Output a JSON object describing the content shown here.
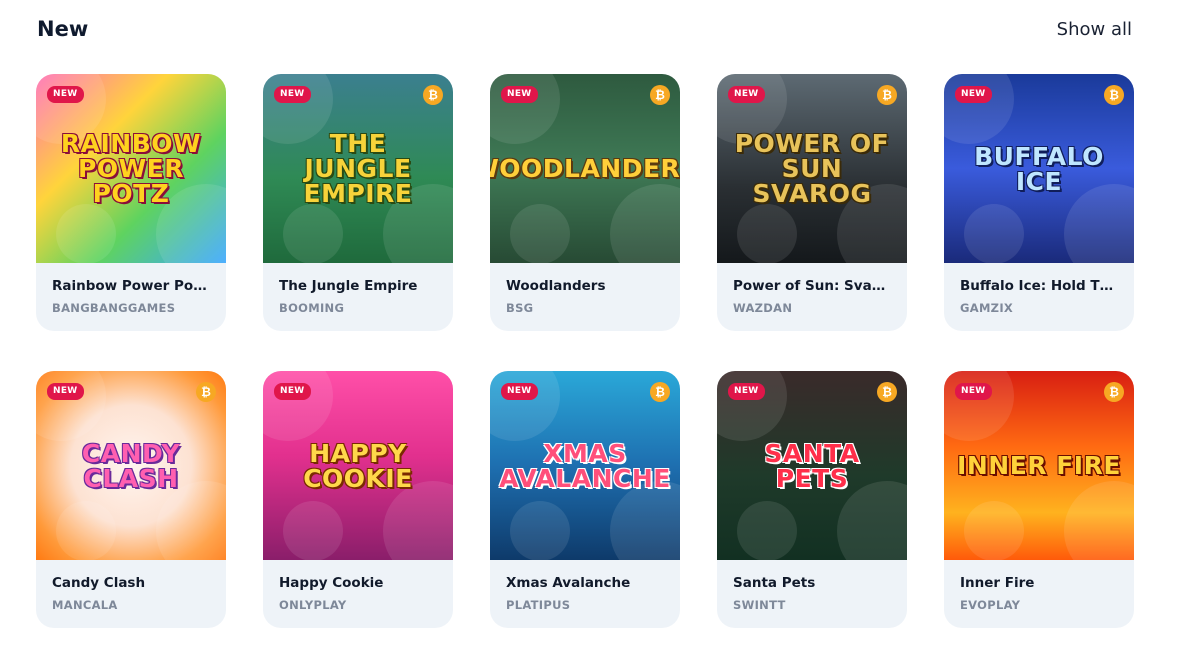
{
  "section": {
    "title": "New",
    "show_all": "Show all"
  },
  "badge_new": "NEW",
  "colors": {
    "badge": "#e0164a",
    "bitcoin": "#f7a823",
    "card_bg": "#eef3f8",
    "provider_text": "#7e8899"
  },
  "games": [
    {
      "name": "Rainbow Power Potz …",
      "provider": "BANGBANGGAMES",
      "thumb_text": "RAINBOW POWER POTZ",
      "btc": false,
      "bg": "linear-gradient(135deg,#ff6fb5 0%,#ffd43b 35%,#5fd35f 65%,#3aa7ff 100%)",
      "fg": "#ffd21f",
      "stroke": "#8a0e3a"
    },
    {
      "name": "The Jungle Empire",
      "provider": "BOOMING",
      "thumb_text": "THE JUNGLE EMPIRE",
      "btc": true,
      "bg": "linear-gradient(180deg,#3b7f8f 0%,#2f8a55 55%,#1f6a3c 100%)",
      "fg": "#f7d33a",
      "stroke": "#2a4a12"
    },
    {
      "name": "Woodlanders",
      "provider": "BSG",
      "thumb_text": "WOODLANDERS",
      "btc": true,
      "bg": "linear-gradient(180deg,#2e5a3f 0%,#3f7a56 50%,#274a34 100%)",
      "fg": "#ffcf3a",
      "stroke": "#5a3a10"
    },
    {
      "name": "Power of Sun: Svarog",
      "provider": "WAZDAN",
      "thumb_text": "POWER OF SUN SVAROG",
      "btc": true,
      "bg": "linear-gradient(180deg,#5d6a73 0%,#2a2f33 60%,#14181b 100%)",
      "fg": "#e8c35a",
      "stroke": "#3a2a08"
    },
    {
      "name": "Buffalo Ice: Hold The …",
      "provider": "GAMZIX",
      "thumb_text": "BUFFALO ICE",
      "btc": true,
      "bg": "linear-gradient(180deg,#1a3a9a 0%,#3a5bdc 50%,#1a2a7a 100%)",
      "fg": "#bfe6ff",
      "stroke": "#101e5a"
    },
    {
      "name": "Candy Clash",
      "provider": "MANCALA",
      "thumb_text": "CANDY CLASH",
      "btc": true,
      "bg": "radial-gradient(circle at 50% 50%,#fff5f0 0%,#fde2d2 45%,#ff9a3a 80%,#ff7a12 100%)",
      "fg": "#ff5fb0",
      "stroke": "#6a2a9a"
    },
    {
      "name": "Happy Cookie",
      "provider": "ONLYPLAY",
      "thumb_text": "HAPPY COOKIE",
      "btc": false,
      "bg": "linear-gradient(180deg,#ff4fa8 0%,#e2308e 45%,#8a1e6a 100%)",
      "fg": "#ffd84a",
      "stroke": "#7a2a00"
    },
    {
      "name": "Xmas Avalanche",
      "provider": "PLATIPUS",
      "thumb_text": "XMAS AVALANCHE",
      "btc": true,
      "bg": "linear-gradient(180deg,#2aa8d8 0%,#1e6fb0 50%,#0e3a6a 100%)",
      "fg": "#ff4f7a",
      "stroke": "#ffffff"
    },
    {
      "name": "Santa Pets",
      "provider": "SWINTT",
      "thumb_text": "SANTA PETS",
      "btc": true,
      "bg": "linear-gradient(180deg,#3a2a2a 0%,#1f3a2a 55%,#123022 100%)",
      "fg": "#ff2f4a",
      "stroke": "#ffffff"
    },
    {
      "name": "Inner Fire",
      "provider": "EVOPLAY",
      "thumb_text": "INNER FIRE",
      "btc": true,
      "bg": "linear-gradient(180deg,#d81e12 0%,#ff6a12 40%,#ffb21e 75%,#ff5a0a 100%)",
      "fg": "#ffd23a",
      "stroke": "#6a0e00"
    }
  ]
}
